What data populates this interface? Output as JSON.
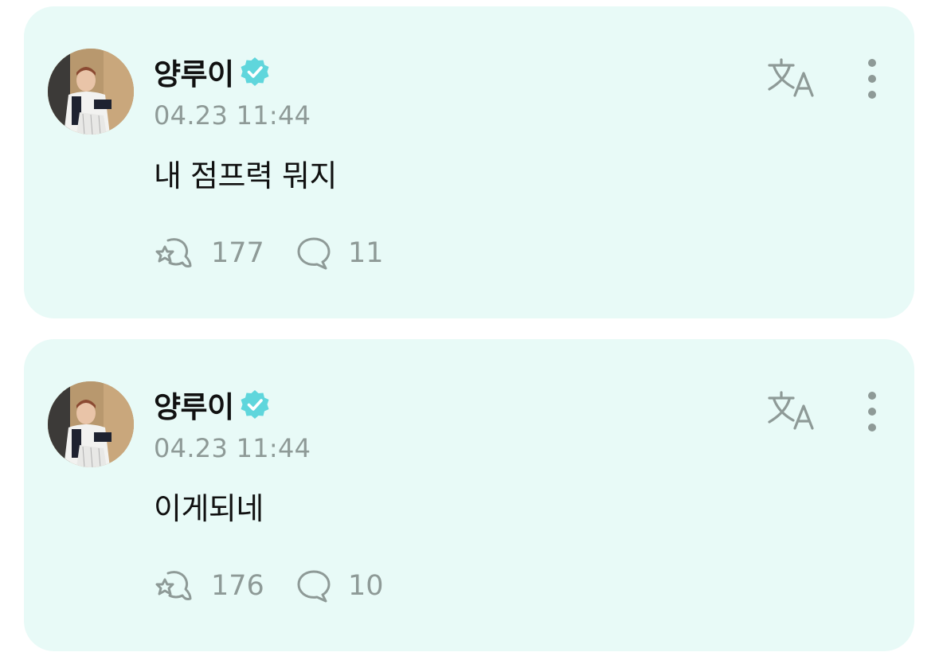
{
  "colors": {
    "card_background": "#e8faf7",
    "verified_badge": "#5fd6dc",
    "muted_text": "#8e9a97",
    "primary_text": "#111111"
  },
  "posts": [
    {
      "author": "양루이",
      "verified_icon": "verified-badge-icon",
      "timestamp": "04.23 11:44",
      "text": "내 점프력 뭐지",
      "likes": "177",
      "comments": "11"
    },
    {
      "author": "양루이",
      "verified_icon": "verified-badge-icon",
      "timestamp": "04.23 11:44",
      "text": "이게되네",
      "likes": "176",
      "comments": "10"
    }
  ],
  "icons": {
    "avatar": "avatar-photo",
    "translate": "translate-icon",
    "more": "more-vertical-icon",
    "like": "like-icon",
    "comment": "comment-icon"
  }
}
